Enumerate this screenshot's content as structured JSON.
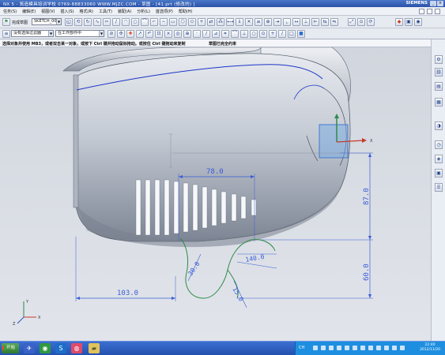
{
  "window": {
    "title": "NX 5 - 筑造模具培训学校  0769-88833060  WWW.MJZC.COM - 草图 - [41.prt  (修改的)  ]",
    "brand": "SIEMENS",
    "controls": {
      "minimize": "_",
      "maximize": "□",
      "close": "×"
    }
  },
  "menubar": {
    "items": [
      "任务(S)",
      "编辑(E)",
      "视图(V)",
      "插入(S)",
      "格式(R)",
      "工具(T)",
      "装配(A)",
      "分析(L)",
      "首选项(P)",
      "帮助(H)"
    ]
  },
  "toolbar1": {
    "finish_sketch_label": "完成草图",
    "sketch_name": "SKETCH_006"
  },
  "toolbar2": {
    "selection_filter": "没有选择过滤器",
    "scope": "在工作部件中"
  },
  "status": {
    "prompt": "选择对象并使用 MB3，或者双击某一对象，或按下 Ctrl 键并拖动鼠标拖动。或按住 Ctrl 键拖动来复制",
    "sketch_state": "草图已完全约束"
  },
  "sketch": {
    "dimensions": {
      "width_top": "78.0",
      "height_right_upper": "87.0",
      "height_right_lower": "60.0",
      "width_bottom": "103.0",
      "angle_right": "140.0",
      "radius_left": "30.0",
      "radius_bottom": "15.0"
    },
    "axis_labels": {
      "x": "X",
      "y": "Y",
      "z": "Z"
    },
    "colors": {
      "dimension": "#3a5cd6",
      "profile": "#2e8a4a",
      "body": "#b9c0cc",
      "edge": "#1a35c8"
    }
  },
  "resource_bar": {
    "icons": [
      "assembly-navigator-icon",
      "constraint-navigator-icon",
      "part-navigator-icon",
      "reuse-library-icon",
      "web-browser-icon",
      "history-icon",
      "system-materials-icon",
      "process-studio-icon",
      "roles-icon"
    ]
  },
  "taskbar": {
    "start_label": "开始",
    "apps": [
      "nx-icon",
      "browser-icon",
      "qq-icon",
      "media-icon",
      "folder-icon"
    ],
    "tray_lang": "CH",
    "time": "22:40",
    "date": "2012/11/20"
  }
}
